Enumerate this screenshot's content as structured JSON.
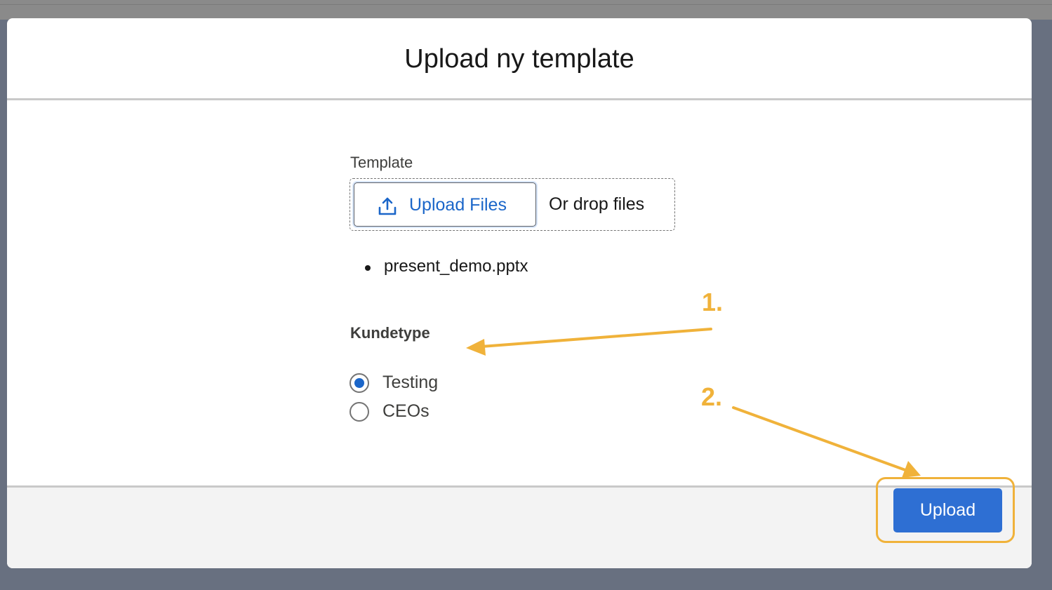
{
  "modal": {
    "title": "Upload ny template"
  },
  "form": {
    "template_label": "Template",
    "upload_files_label": "Upload Files",
    "drop_label": "Or drop files",
    "files": [
      "present_demo.pptx"
    ],
    "kundetype_label": "Kundetype",
    "options": [
      {
        "label": "Testing",
        "checked": true
      },
      {
        "label": "CEOs",
        "checked": false
      }
    ]
  },
  "footer": {
    "upload_label": "Upload"
  },
  "annotations": {
    "step1": "1.",
    "step2": "2.",
    "color": "#f0b23a"
  },
  "colors": {
    "brand": "#2e6fd3",
    "link": "#1b66c9",
    "backdrop": "#687080"
  },
  "icons": {
    "upload": "upload-icon"
  }
}
